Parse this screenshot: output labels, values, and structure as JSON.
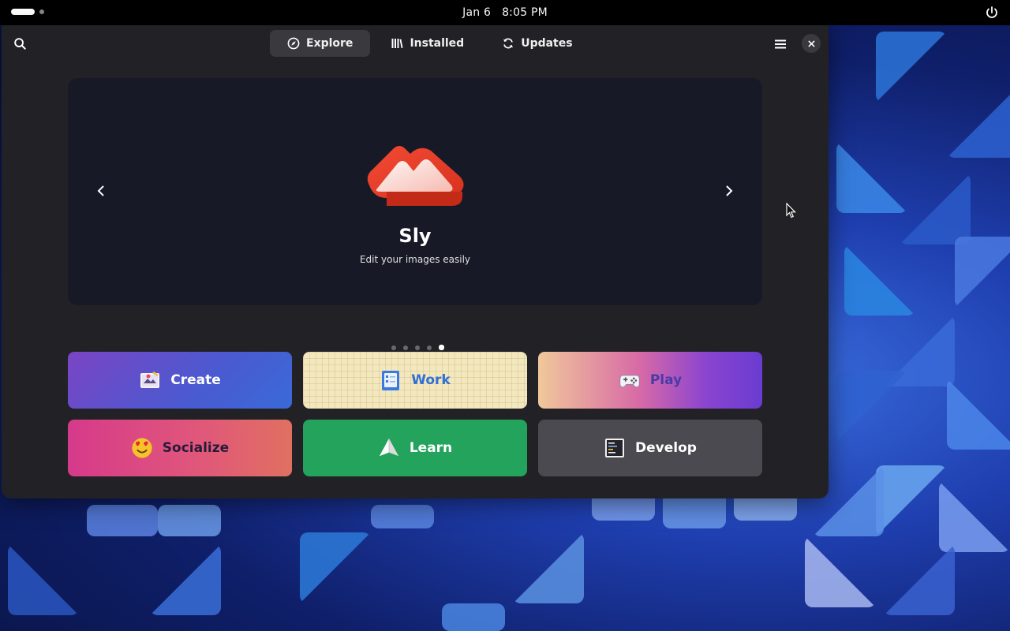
{
  "topbar": {
    "date": "Jan 6",
    "time": "8:05 PM",
    "power_icon": "power-icon"
  },
  "header": {
    "search_icon": "search-icon",
    "tabs": [
      {
        "label": "Explore",
        "icon": "compass-icon",
        "active": true
      },
      {
        "label": "Installed",
        "icon": "library-icon",
        "active": false
      },
      {
        "label": "Updates",
        "icon": "refresh-icon",
        "active": false
      }
    ],
    "menu_icon": "hamburger-icon",
    "close_icon": "close-icon"
  },
  "featured": {
    "app_name": "Sly",
    "app_description": "Edit your images easily",
    "slide_count": 5,
    "active_slide": 5
  },
  "categories": [
    {
      "label": "Create",
      "icon": "create-icon"
    },
    {
      "label": "Work",
      "icon": "clipboard-icon"
    },
    {
      "label": "Play",
      "icon": "gamepad-icon"
    },
    {
      "label": "Socialize",
      "icon": "smiley-icon"
    },
    {
      "label": "Learn",
      "icon": "paper-plane-icon"
    },
    {
      "label": "Develop",
      "icon": "terminal-icon"
    }
  ],
  "colors": {
    "window_bg": "#222226",
    "carousel_bg": "#171a26",
    "accent_red": "#e8432e"
  }
}
